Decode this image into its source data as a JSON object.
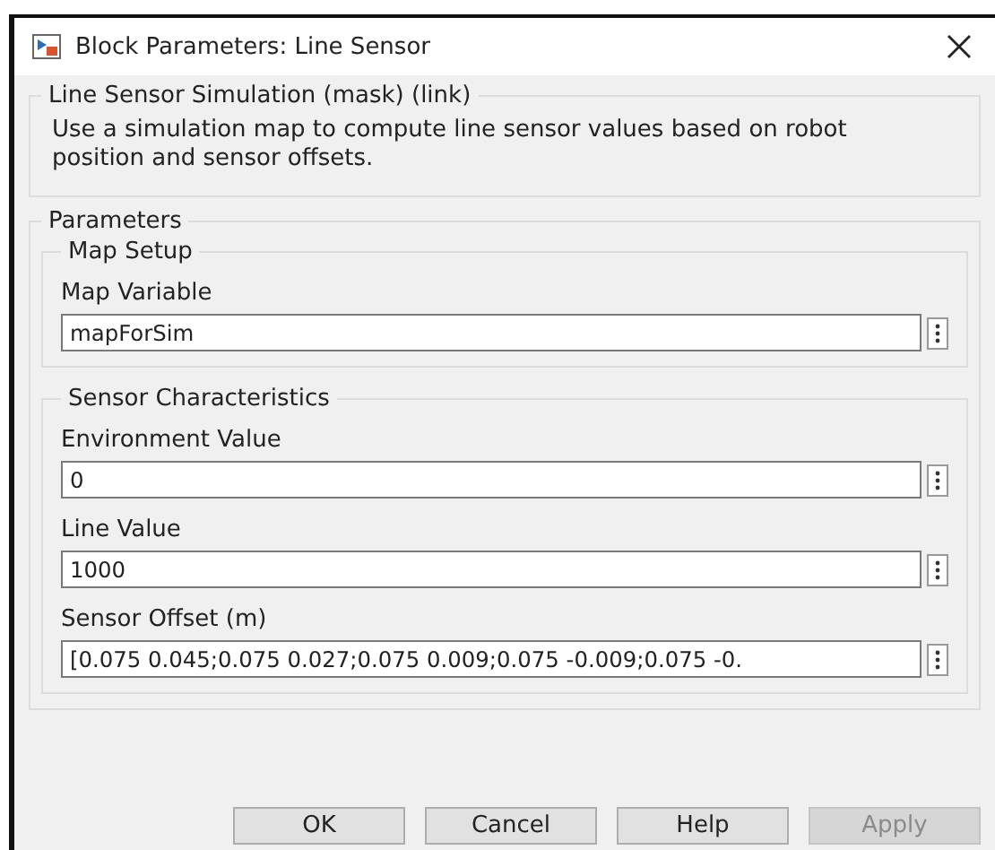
{
  "window": {
    "title": "Block Parameters: Line Sensor"
  },
  "mask": {
    "title": "Line Sensor Simulation (mask) (link)",
    "description": "Use a simulation map to compute line sensor values based on robot position and sensor offsets."
  },
  "parameters": {
    "title": "Parameters",
    "groups": [
      {
        "title": "Map Setup",
        "fields": [
          {
            "label": "Map Variable",
            "value": "mapForSim"
          }
        ]
      },
      {
        "title": "Sensor Characteristics",
        "fields": [
          {
            "label": "Environment Value",
            "value": "0"
          },
          {
            "label": "Line Value",
            "value": "1000"
          },
          {
            "label": "Sensor Offset (m)",
            "value": "[0.075 0.045;0.075 0.027;0.075 0.009;0.075 -0.009;0.075 -0."
          }
        ]
      }
    ]
  },
  "buttons": [
    {
      "label": "OK",
      "disabled": false
    },
    {
      "label": "Cancel",
      "disabled": false
    },
    {
      "label": "Help",
      "disabled": false
    },
    {
      "label": "Apply",
      "disabled": true
    }
  ]
}
